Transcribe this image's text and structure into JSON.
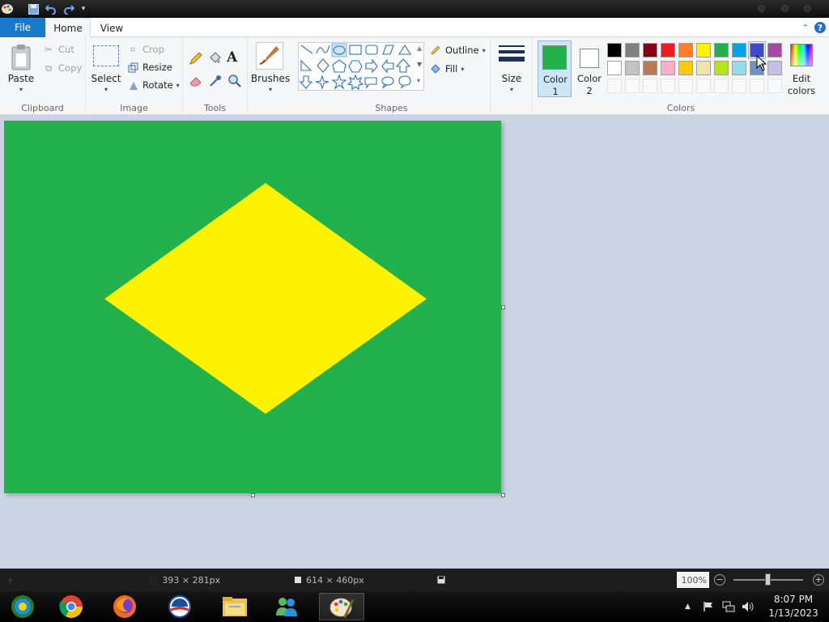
{
  "tabs": {
    "file": "File",
    "home": "Home",
    "view": "View"
  },
  "ribbon": {
    "clipboard": {
      "label": "Clipboard",
      "paste": "Paste",
      "cut": "Cut",
      "copy": "Copy"
    },
    "image": {
      "label": "Image",
      "select": "Select",
      "crop": "Crop",
      "resize": "Resize",
      "rotate": "Rotate"
    },
    "tools": {
      "label": "Tools"
    },
    "brushes": {
      "label": "Brushes"
    },
    "shapes": {
      "label": "Shapes",
      "outline": "Outline",
      "fill": "Fill"
    },
    "size": {
      "label": "Size"
    },
    "colors": {
      "label": "Colors",
      "color1_label": "Color",
      "color1_num": "1",
      "color2_label": "Color",
      "color2_num": "2",
      "color1_value": "#22b14c",
      "color2_value": "#ffffff",
      "edit_colors_1": "Edit",
      "edit_colors_2": "colors",
      "palette_row1": [
        "#000000",
        "#7f7f7f",
        "#880015",
        "#ed1c24",
        "#ff7f27",
        "#fff200",
        "#22b14c",
        "#00a2e8",
        "#3f48cc",
        "#a349a4"
      ],
      "palette_row2": [
        "#ffffff",
        "#c3c3c3",
        "#b97a57",
        "#ffaec9",
        "#ffc90e",
        "#efe4b0",
        "#b5e61d",
        "#99d9ea",
        "#7092be",
        "#c8bfe7"
      ]
    }
  },
  "canvas": {
    "background": "#22b14c",
    "diamond_color": "#fff200"
  },
  "status": {
    "cursor_pos": "393 × 281px",
    "canvas_size": "614 × 460px",
    "zoom": "100%"
  },
  "taskbar": {
    "time": "8:07 PM",
    "date": "1/13/2023",
    "apps": [
      "media-center-icon",
      "chrome-icon",
      "firefox-icon",
      "obama-logo-icon",
      "file-explorer-icon",
      "messenger-icon",
      "paint-icon"
    ]
  }
}
